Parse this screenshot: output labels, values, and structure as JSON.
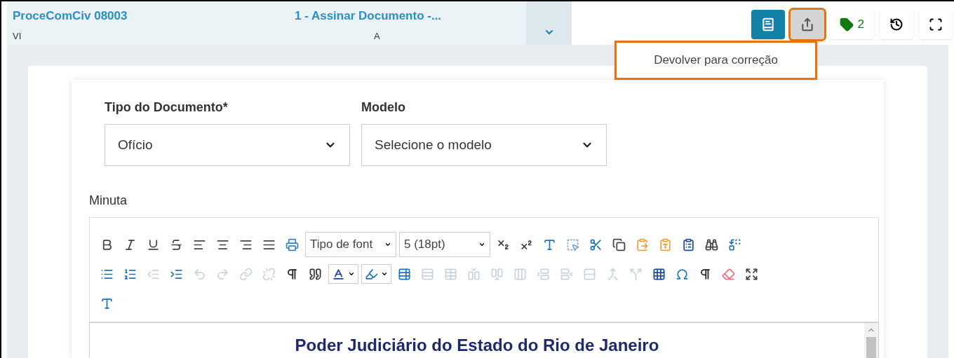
{
  "header": {
    "process": "ProceComCiv 08003",
    "process_sub": "VI",
    "task": "1 - Assinar Documento -...",
    "task_sub": "A"
  },
  "actions": [
    {
      "kind": "notes",
      "active": true,
      "highlighted": false
    },
    {
      "kind": "share",
      "active": false,
      "highlighted": true
    },
    {
      "kind": "tags",
      "active": false,
      "highlighted": false,
      "count": "2"
    },
    {
      "kind": "history",
      "active": false,
      "highlighted": false
    },
    {
      "kind": "fullscreen",
      "active": false,
      "highlighted": false
    }
  ],
  "menu": {
    "highlighted": true,
    "items": [
      "Devolver para correção"
    ]
  },
  "fields": [
    {
      "label": "Tipo do Documento*",
      "value": "Ofício"
    },
    {
      "label": "Modelo",
      "value": "Selecione o modelo"
    }
  ],
  "editor": {
    "label": "Minuta",
    "toolbar": [
      [
        {
          "kind": "bold",
          "disabled": false
        },
        {
          "kind": "italic",
          "disabled": false
        },
        {
          "kind": "underline",
          "disabled": false
        },
        {
          "kind": "strike",
          "disabled": false
        },
        {
          "kind": "align-left",
          "disabled": false
        },
        {
          "kind": "align-center",
          "disabled": false
        },
        {
          "kind": "align-right",
          "disabled": false
        },
        {
          "kind": "justify",
          "disabled": false
        },
        {
          "kind": "print",
          "disabled": false
        },
        {
          "kind": "select",
          "text": "Tipo de font"
        },
        {
          "kind": "select",
          "text": "5 (18pt)"
        },
        {
          "kind": "subscript",
          "disabled": false
        },
        {
          "kind": "superscript",
          "disabled": false
        },
        {
          "kind": "spacing",
          "disabled": false
        },
        {
          "kind": "select-all",
          "disabled": false
        },
        {
          "kind": "cut",
          "disabled": false
        },
        {
          "kind": "copy",
          "disabled": false
        },
        {
          "kind": "paste",
          "disabled": false
        },
        {
          "kind": "paste-text",
          "disabled": false
        },
        {
          "kind": "paste-word",
          "disabled": false
        },
        {
          "kind": "find",
          "disabled": false
        },
        {
          "kind": "replace",
          "disabled": false
        }
      ],
      [
        {
          "kind": "bullets",
          "disabled": false
        },
        {
          "kind": "numbers",
          "disabled": false
        },
        {
          "kind": "outdent",
          "disabled": true
        },
        {
          "kind": "indent",
          "disabled": false
        },
        {
          "kind": "undo",
          "disabled": true
        },
        {
          "kind": "redo",
          "disabled": true
        },
        {
          "kind": "link",
          "disabled": true
        },
        {
          "kind": "unlink",
          "disabled": true
        },
        {
          "kind": "block",
          "disabled": false
        },
        {
          "kind": "quote",
          "disabled": false
        },
        {
          "kind": "text-color",
          "disabled": false
        },
        {
          "kind": "highlight",
          "disabled": false
        },
        {
          "kind": "table-edit",
          "disabled": false
        },
        {
          "kind": "table-rows",
          "disabled": true
        },
        {
          "kind": "table",
          "disabled": true
        },
        {
          "kind": "insert-left",
          "disabled": true
        },
        {
          "kind": "insert-right",
          "disabled": true
        },
        {
          "kind": "delete-column",
          "disabled": true
        },
        {
          "kind": "insert-above",
          "disabled": true
        },
        {
          "kind": "insert-below",
          "disabled": true
        },
        {
          "kind": "delete-row",
          "disabled": true
        },
        {
          "kind": "merge",
          "disabled": true
        },
        {
          "kind": "split",
          "disabled": true
        },
        {
          "kind": "grid",
          "disabled": false
        },
        {
          "kind": "omega",
          "disabled": false
        },
        {
          "kind": "pilcrow",
          "disabled": false
        },
        {
          "kind": "eraser",
          "disabled": false
        },
        {
          "kind": "maximize",
          "disabled": false
        }
      ],
      [
        {
          "kind": "spacing",
          "disabled": false
        }
      ]
    ],
    "heading": "Poder Judiciário do Estado do Rio de Janeiro"
  }
}
